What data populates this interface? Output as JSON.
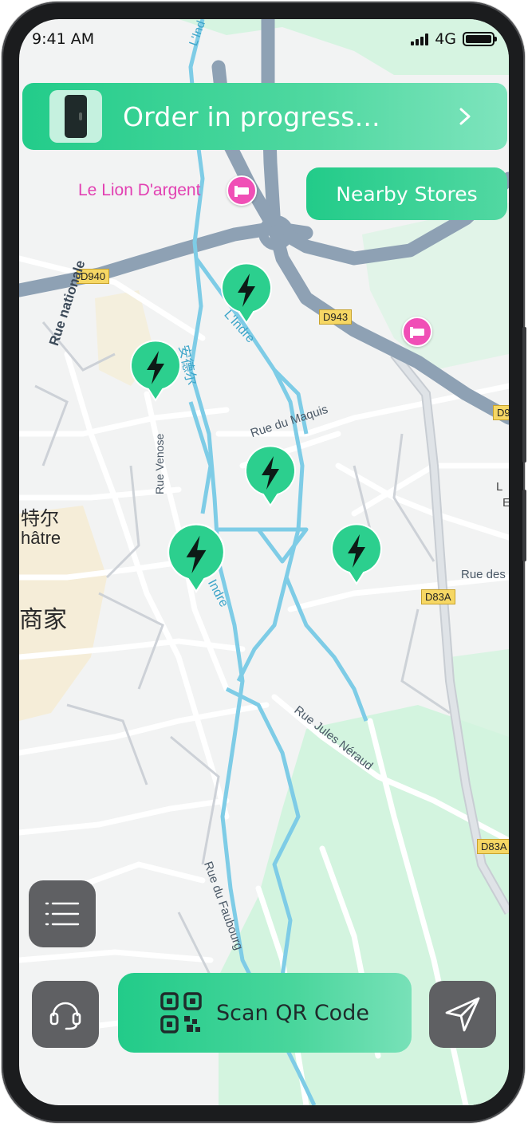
{
  "status_bar": {
    "time": "9:41 AM",
    "network": "4G"
  },
  "order_banner": {
    "text": "Order in progress...",
    "chevron_icon": "chevron-right-icon"
  },
  "nearby_button": {
    "label": "Nearby Stores"
  },
  "map": {
    "poi_hotel": "Le Lion D'argent",
    "road_d940": "D940",
    "road_d943": "D943",
    "road_d83a": "D83A",
    "road_d83a_2": "D83A",
    "road_d9_partial": "D9",
    "street_rue_nationale": "Rue nationale",
    "street_rue_venose": "Rue Venose",
    "street_rue_du_maquis": "Rue du Maquis",
    "street_rue_jules_neraud": "Rue Jules Néraud",
    "street_rue_du_faubourg": "Rue du Faubourg",
    "street_rue_des": "Rue des",
    "river_lindre_1": "L'Indre",
    "river_lindre_2": "L'Indre",
    "river_lindre_top": "L'Ind",
    "river_lindre_3": "Indre",
    "river_cn": "安德尔",
    "town_cn": "特尔",
    "town_fr": "hâtre",
    "merchant_cn": "商家",
    "right_edge_l": "L",
    "right_edge_e": "E"
  },
  "charging_pins": {
    "count": 5,
    "icon": "lightning-bolt-icon",
    "color": "#2ccf8e"
  },
  "menu_button": {
    "icon": "menu-icon"
  },
  "support_button": {
    "icon": "headset-icon"
  },
  "scan_button": {
    "label": "Scan QR Code",
    "icon": "qr-code-icon"
  },
  "navigate_button": {
    "icon": "navigation-arrow-icon"
  },
  "colors": {
    "accent": "#2ccf8e",
    "accent_light": "#7ee4bd",
    "dark_button": "#5f6063",
    "water": "#7ecce6",
    "major_road": "#8ea1b4"
  }
}
